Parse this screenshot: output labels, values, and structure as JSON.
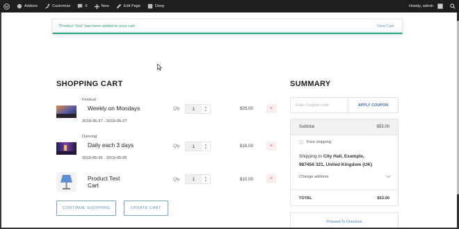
{
  "adminbar": {
    "addons": "Addons",
    "customize": "Customize",
    "comments": "0",
    "new": "New",
    "edit_page": "Edit Page",
    "deep": "Deep",
    "howdy": "Howdy, admin"
  },
  "notice": {
    "message": "“Product Test” has been added to your cart.",
    "link": "View Cart"
  },
  "cart": {
    "title": "SHOPPING CART",
    "qty_label": "Qty",
    "items": [
      {
        "category": "Festival",
        "name": "Weekly on Mondays",
        "dates": "2019-05-27 - 2019-05-27",
        "qty": "1",
        "price": "$25.00",
        "remove": "×"
      },
      {
        "category": "Dancing",
        "name": "Daily each 3 days",
        "dates": "2019-05-26 - 2019-05-26",
        "qty": "1",
        "price": "$18.00",
        "remove": "×"
      },
      {
        "category": "",
        "name_line1": "Product Test",
        "name_line2": "Cart",
        "qty": "1",
        "price": "$10.00",
        "remove": "×"
      }
    ],
    "continue_label": "CONTINUE SHOPPING",
    "update_label": "UPDATE CART"
  },
  "summary": {
    "title": "SUMMARY",
    "coupon_placeholder": "Enter Coupon code",
    "apply_label": "APPLY COUPON",
    "subtotal_label": "Subtotal",
    "subtotal_value": "$53.00",
    "shipping_option": "Free shipping",
    "shipping_to_prefix": "Shipping to",
    "shipping_address_1": "City Hall, Example,",
    "shipping_address_2": "987456 321, United Kingdom (UK)",
    "change_address": "Change address",
    "total_label": "TOTAL",
    "total_value": "$53.00",
    "checkout_label": "Proceed To Checkout"
  }
}
